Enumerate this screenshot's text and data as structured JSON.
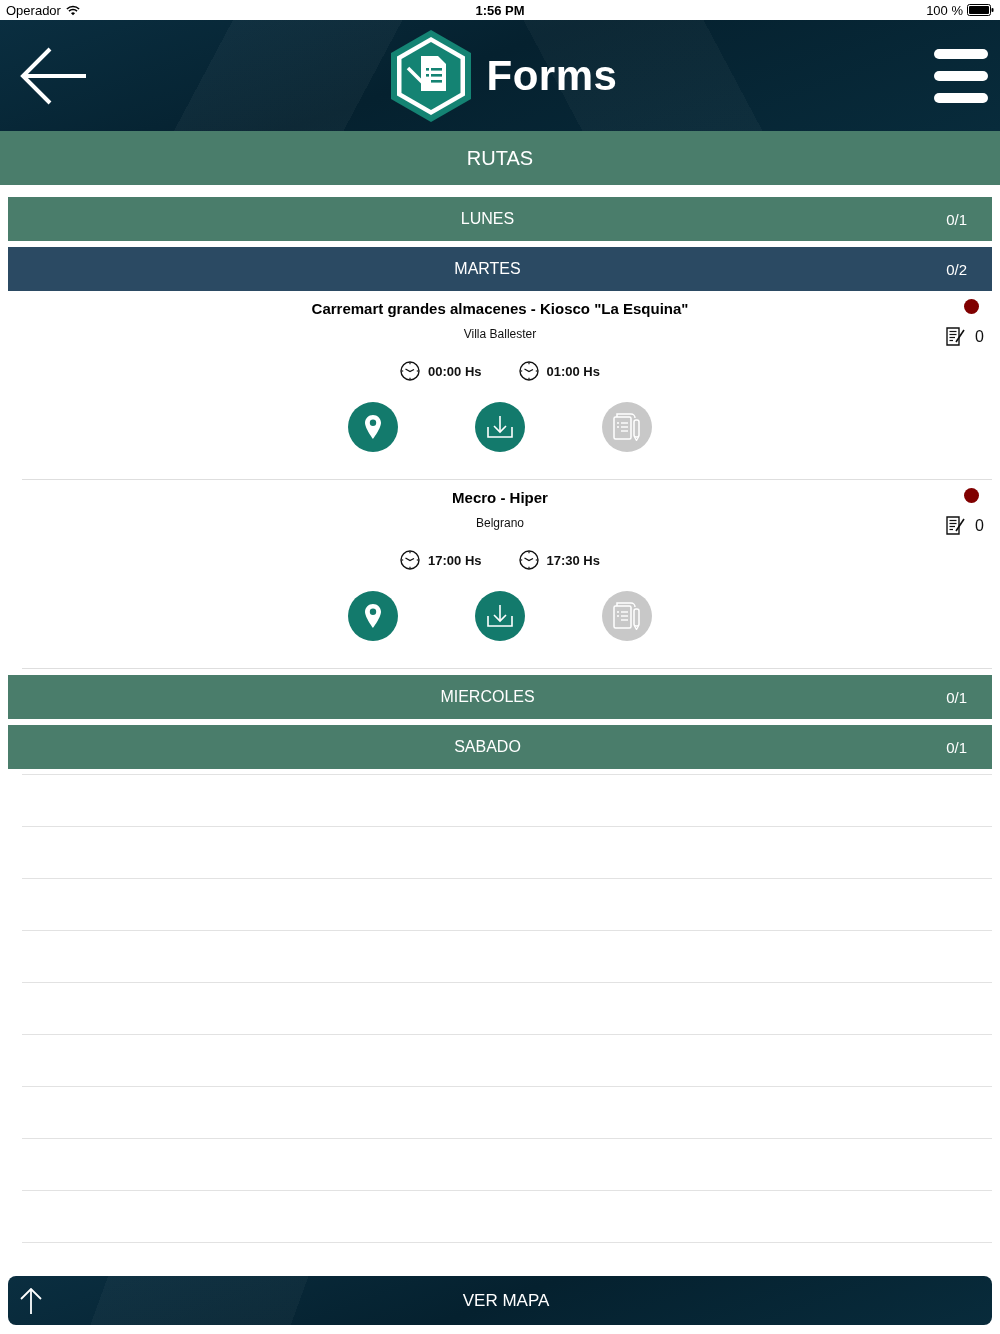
{
  "status_bar": {
    "carrier": "Operador",
    "time": "1:56 PM",
    "battery": "100 %"
  },
  "header": {
    "title": "Forms"
  },
  "section": {
    "title": "RUTAS"
  },
  "days": [
    {
      "name": "LUNES",
      "count": "0/1",
      "expanded": false
    },
    {
      "name": "MARTES",
      "count": "0/2",
      "expanded": true,
      "visits": [
        {
          "title": "Carremart grandes almacenes - Kiosco \"La Esquina\"",
          "location": "Villa Ballester",
          "times": [
            "00:00 Hs",
            "01:00 Hs"
          ],
          "color": "#800000",
          "forms_count": "0",
          "actions": [
            {
              "kind": "map",
              "disabled": false
            },
            {
              "kind": "download",
              "disabled": false
            },
            {
              "kind": "forms",
              "disabled": true
            }
          ]
        },
        {
          "title": "Mecro - Hiper",
          "location": "Belgrano",
          "times": [
            "17:00 Hs",
            "17:30 Hs"
          ],
          "color": "#800000",
          "forms_count": "0",
          "actions": [
            {
              "kind": "map",
              "disabled": false
            },
            {
              "kind": "download",
              "disabled": false
            },
            {
              "kind": "forms",
              "disabled": true
            }
          ]
        }
      ]
    },
    {
      "name": "MIERCOLES",
      "count": "0/1",
      "expanded": false
    },
    {
      "name": "SABADO",
      "count": "0/1",
      "expanded": false
    }
  ],
  "footer": {
    "button": "VER MAPA"
  }
}
